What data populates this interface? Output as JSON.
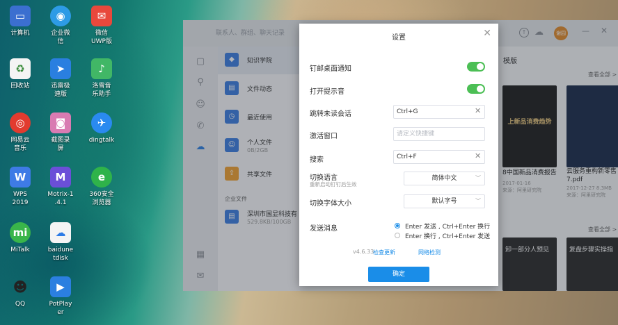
{
  "desktop": {
    "icons": [
      {
        "label": "计算机",
        "icon": "computer-icon",
        "color": "#3b6fd0"
      },
      {
        "label": "企业微\n信",
        "icon": "wecom-icon",
        "color": "#2d9be6"
      },
      {
        "label": "微信\nUWP版",
        "icon": "wechat-icon",
        "color": "#e8483c"
      },
      {
        "label": "回收站",
        "icon": "recycle-bin-icon",
        "color": "#ffffff"
      },
      {
        "label": "迅雷极\n速版",
        "icon": "thunder-icon",
        "color": "#2a7fe0"
      },
      {
        "label": "洛雪音\n乐助手",
        "icon": "music-icon",
        "color": "#41b766"
      },
      {
        "label": "网易云\n音乐",
        "icon": "netease-music-icon",
        "color": "#e23b2f"
      },
      {
        "label": "截图录\n屏",
        "icon": "camera-icon",
        "color": "#d97bb2"
      },
      {
        "label": "dingtalk",
        "icon": "dingtalk-icon",
        "color": "#2a8af0"
      },
      {
        "label": "WPS\n2019",
        "icon": "wps-icon",
        "color": "#3e7be6"
      },
      {
        "label": "Motrix-1\n.4.1",
        "icon": "motrix-icon",
        "color": "#6b4fd8"
      },
      {
        "label": "360安全\n浏览器",
        "icon": "360-browser-icon",
        "color": "#2fb34a"
      },
      {
        "label": "MiTalk",
        "icon": "mitalk-icon",
        "color": "#39b54a"
      },
      {
        "label": "baidune\ntdisk",
        "icon": "baidu-netdisk-icon",
        "color": "#ffffff"
      },
      {
        "label": "QQ",
        "icon": "qq-icon",
        "color": "#222222"
      },
      {
        "label": "PotPlay\ner",
        "icon": "potplayer-icon",
        "color": "#2b7fe0"
      }
    ]
  },
  "app": {
    "search_placeholder": "联系人、群组、聊天记录",
    "user_avatar": "谢园",
    "list": [
      {
        "title": "知识学院",
        "sub": ""
      },
      {
        "title": "文件动态",
        "sub": ""
      },
      {
        "title": "最近使用",
        "sub": ""
      },
      {
        "title": "个人文件",
        "sub": "0B/2GB"
      },
      {
        "title": "共享文件",
        "sub": ""
      }
    ],
    "enterprise_header": "企业文件",
    "enterprise_item": {
      "title": "深圳市国显科技有",
      "sub": "529.8KB/100GB"
    },
    "right_tab": "模版",
    "see_all_1": "查看全部 >",
    "see_all_2": "查看全部 >",
    "card_title": "8中国新品消费报告",
    "card_date": "2017-01-16",
    "card_source": "来源：阿里研究院",
    "card2_title": "云服务重构新零售\n7.pdf",
    "card2_date": "2017-12-27  8.3MB",
    "card2_source": "来源：阿里研究院",
    "card3_title": "卸一部分人预见",
    "card4_title": "复盘步骤实操指"
  },
  "settings": {
    "title": "设置",
    "rows": {
      "pin_notify": "钉邮桌面通知",
      "sound": "打开提示音",
      "jump_unread": "跳转未读会话",
      "jump_unread_value": "Ctrl+G",
      "activate_window": "激活窗口",
      "activate_placeholder": "请定义快捷键",
      "search": "搜索",
      "search_value": "Ctrl+F",
      "language": "切换语言",
      "language_sub": "重新启动钉钉后生效",
      "language_value": "简体中文",
      "font_size": "切换字体大小",
      "font_size_value": "默认字号",
      "send_msg": "发送消息",
      "send_opt1": "Enter 发送 , Ctrl+Enter 换行",
      "send_opt2": "Enter 换行 , Ctrl+Enter 发送"
    },
    "version": "v4.6.33",
    "check_update": "检查更新",
    "network_check": "网络检测",
    "ok_label": "确定",
    "colors": {
      "accent": "#1a8de8",
      "toggle_on": "#4cbf55"
    }
  }
}
